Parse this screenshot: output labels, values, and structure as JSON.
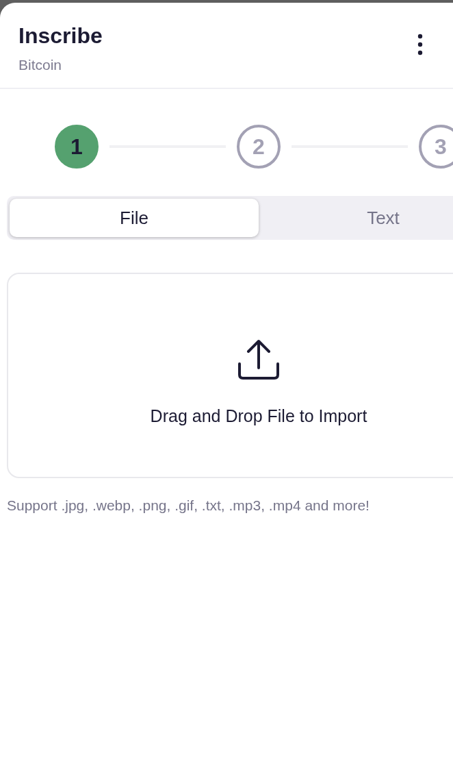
{
  "header": {
    "title": "Inscribe",
    "subtitle": "Bitcoin"
  },
  "steps": [
    {
      "label": "1",
      "selected": true
    },
    {
      "label": "2",
      "selected": false
    },
    {
      "label": "3",
      "selected": false
    }
  ],
  "tabs": [
    {
      "label": "File",
      "selected": true
    },
    {
      "label": "Text",
      "selected": false
    }
  ],
  "dropzone": {
    "label": "Drag and Drop File to Import"
  },
  "hint": "Support .jpg, .webp, .png, .gif, .txt, .mp3, .mp4 and more!"
}
